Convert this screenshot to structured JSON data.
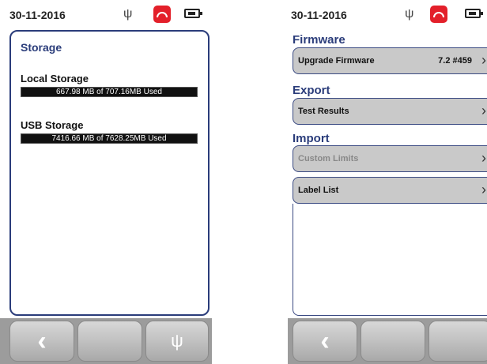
{
  "left": {
    "status": {
      "date": "30-11-2016"
    },
    "panel": {
      "title": "Storage",
      "local": {
        "label": "Local Storage",
        "usage": "667.98 MB of 707.16MB Used"
      },
      "usb": {
        "label": "USB Storage",
        "usage": "7416.66 MB of 7628.25MB Used"
      }
    },
    "softkeys": [
      "back",
      "blank",
      "usb"
    ]
  },
  "right": {
    "status": {
      "date": "30-11-2016"
    },
    "sections": {
      "firmware": "Firmware",
      "export": "Export",
      "import": "Import"
    },
    "items": {
      "upgrade_firmware": {
        "label": "Upgrade Firmware",
        "value": "7.2  #459"
      },
      "test_results": {
        "label": "Test Results"
      },
      "custom_limits": {
        "label": "Custom Limits",
        "enabled": false
      },
      "label_list": {
        "label": "Label List"
      }
    }
  },
  "icons": {
    "usb": "usb-icon",
    "phone": "phone-hangup-icon",
    "battery": "battery-icon",
    "back": "chevron-left-icon",
    "chevron": "chevron-right-icon"
  },
  "colors": {
    "accent": "#2a3c7a",
    "hangup": "#e3202a",
    "menu_bg": "#c9c9c9",
    "softkey_bar": "#9c9c9c"
  }
}
